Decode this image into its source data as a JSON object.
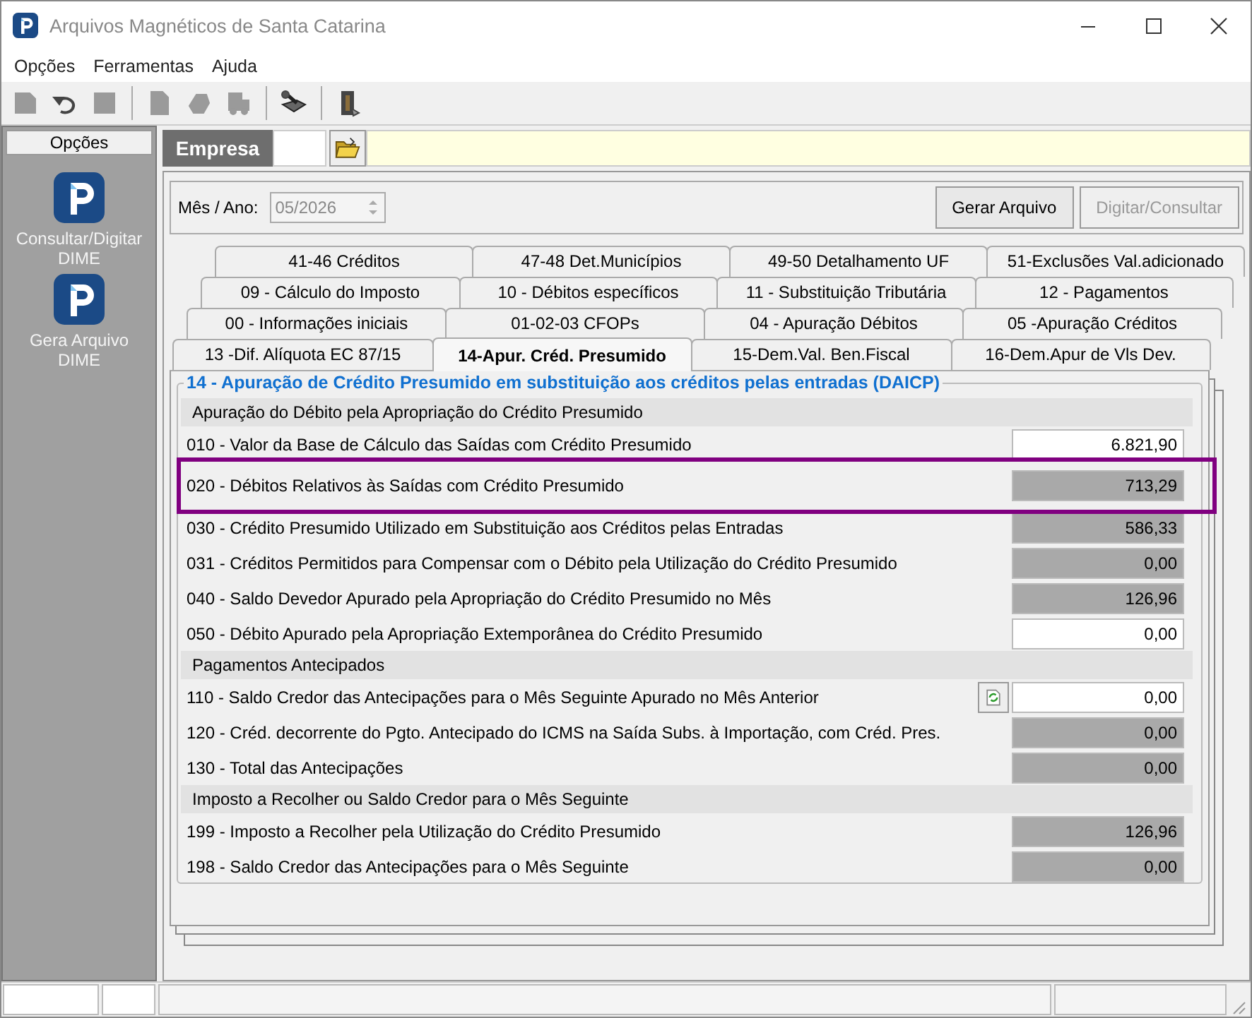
{
  "window": {
    "title": "Arquivos Magnéticos de Santa Catarina"
  },
  "menu": [
    "Opções",
    "Ferramentas",
    "Ajuda"
  ],
  "toolbar": [
    {
      "disabled": true
    },
    {
      "disabled": false
    },
    {
      "disabled": true
    },
    {
      "disabled": true
    },
    {
      "disabled": true
    },
    {
      "disabled": true
    },
    {
      "disabled": false
    },
    {
      "disabled": false
    }
  ],
  "sidebar": {
    "header": "Opções",
    "items": [
      {
        "label": "Consultar/Digitar\nDIME"
      },
      {
        "label": "Gera Arquivo\nDIME"
      }
    ]
  },
  "company": {
    "label": "Empresa"
  },
  "period": {
    "label": "Mês / Ano:",
    "value": "05/2026",
    "disabled": true
  },
  "buttons": [
    {
      "label": "Gerar Arquivo",
      "disabled": false
    },
    {
      "label": "Digitar/Consultar",
      "disabled": true
    }
  ],
  "tab_rows": [
    [
      {
        "label": "41-46   Créditos",
        "selected": false
      },
      {
        "label": "47-48   Det.Municípios",
        "selected": false
      },
      {
        "label": "49-50   Detalhamento UF",
        "selected": false
      },
      {
        "label": "51-Exclusões Val.adicionado",
        "selected": false
      }
    ],
    [
      {
        "label": "09 - Cálculo do Imposto",
        "selected": false
      },
      {
        "label": "10 - Débitos específicos",
        "selected": false
      },
      {
        "label": "11 -  Substituição Tributária",
        "selected": false
      },
      {
        "label": "12 - Pagamentos",
        "selected": false
      }
    ],
    [
      {
        "label": "00 - Informações iniciais",
        "selected": false
      },
      {
        "label": "01-02-03   CFOPs",
        "selected": false
      },
      {
        "label": "04 - Apuração Débitos",
        "selected": false
      },
      {
        "label": "05 -Apuração Créditos",
        "selected": false
      }
    ],
    [
      {
        "label": "13 -Dif. Alíquota EC 87/15",
        "selected": false
      },
      {
        "label": "14-Apur. Créd. Presumido",
        "selected": true
      },
      {
        "label": "15-Dem.Val. Ben.Fiscal",
        "selected": false
      },
      {
        "label": "16-Dem.Apur de Vls Dev.",
        "selected": false
      }
    ]
  ],
  "group": {
    "title": "14 - Apuração de Crédito Presumido em substituição aos créditos pelas entradas (DAICP)",
    "sections": [
      {
        "title": "Apuração do Débito pela Apropriação do Crédito Presumido",
        "rows": [
          {
            "label": "010 - Valor da Base de Cálculo das Saídas com Crédito Presumido",
            "value": "6.821,90",
            "editable": true,
            "highlighted": false
          },
          {
            "label": "020 - Débitos Relativos às Saídas com Crédito Presumido",
            "value": "713,29",
            "editable": false,
            "highlighted": true
          },
          {
            "label": "030 - Crédito Presumido Utilizado em Substituição aos Créditos pelas Entradas",
            "value": "586,33",
            "editable": false,
            "highlighted": false
          },
          {
            "label": "031 - Créditos Permitidos para Compensar com o Débito pela Utilização do Crédito Presumido",
            "value": "0,00",
            "editable": false,
            "highlighted": false
          },
          {
            "label": "040 - Saldo Devedor Apurado pela Apropriação do Crédito Presumido no Mês",
            "value": "126,96",
            "editable": false,
            "highlighted": false
          },
          {
            "label": "050 - Débito Apurado pela Apropriação Extemporânea do Crédito Presumido",
            "value": "0,00",
            "editable": true,
            "highlighted": false
          }
        ]
      },
      {
        "title": "Pagamentos Antecipados",
        "rows": [
          {
            "label": "110 - Saldo Credor das Antecipações para o Mês Seguinte Apurado no Mês Anterior",
            "value": "0,00",
            "editable": true,
            "highlighted": false,
            "refresh_button": true
          },
          {
            "label": "120 - Créd. decorrente do Pgto. Antecipado do ICMS na Saída Subs. à Importação, com Créd. Pres.",
            "value": "0,00",
            "editable": false,
            "highlighted": false
          },
          {
            "label": "130 - Total das Antecipações",
            "value": "0,00",
            "editable": false,
            "highlighted": false
          }
        ]
      },
      {
        "title": "Imposto a Recolher ou Saldo Credor para o Mês Seguinte",
        "rows": [
          {
            "label": "199 - Imposto a Recolher pela Utilização do Crédito Presumido",
            "value": "126,96",
            "editable": false,
            "highlighted": false
          },
          {
            "label": "198 - Saldo Credor das Antecipações para o Mês Seguinte",
            "value": "0,00",
            "editable": false,
            "highlighted": false
          }
        ]
      }
    ]
  }
}
